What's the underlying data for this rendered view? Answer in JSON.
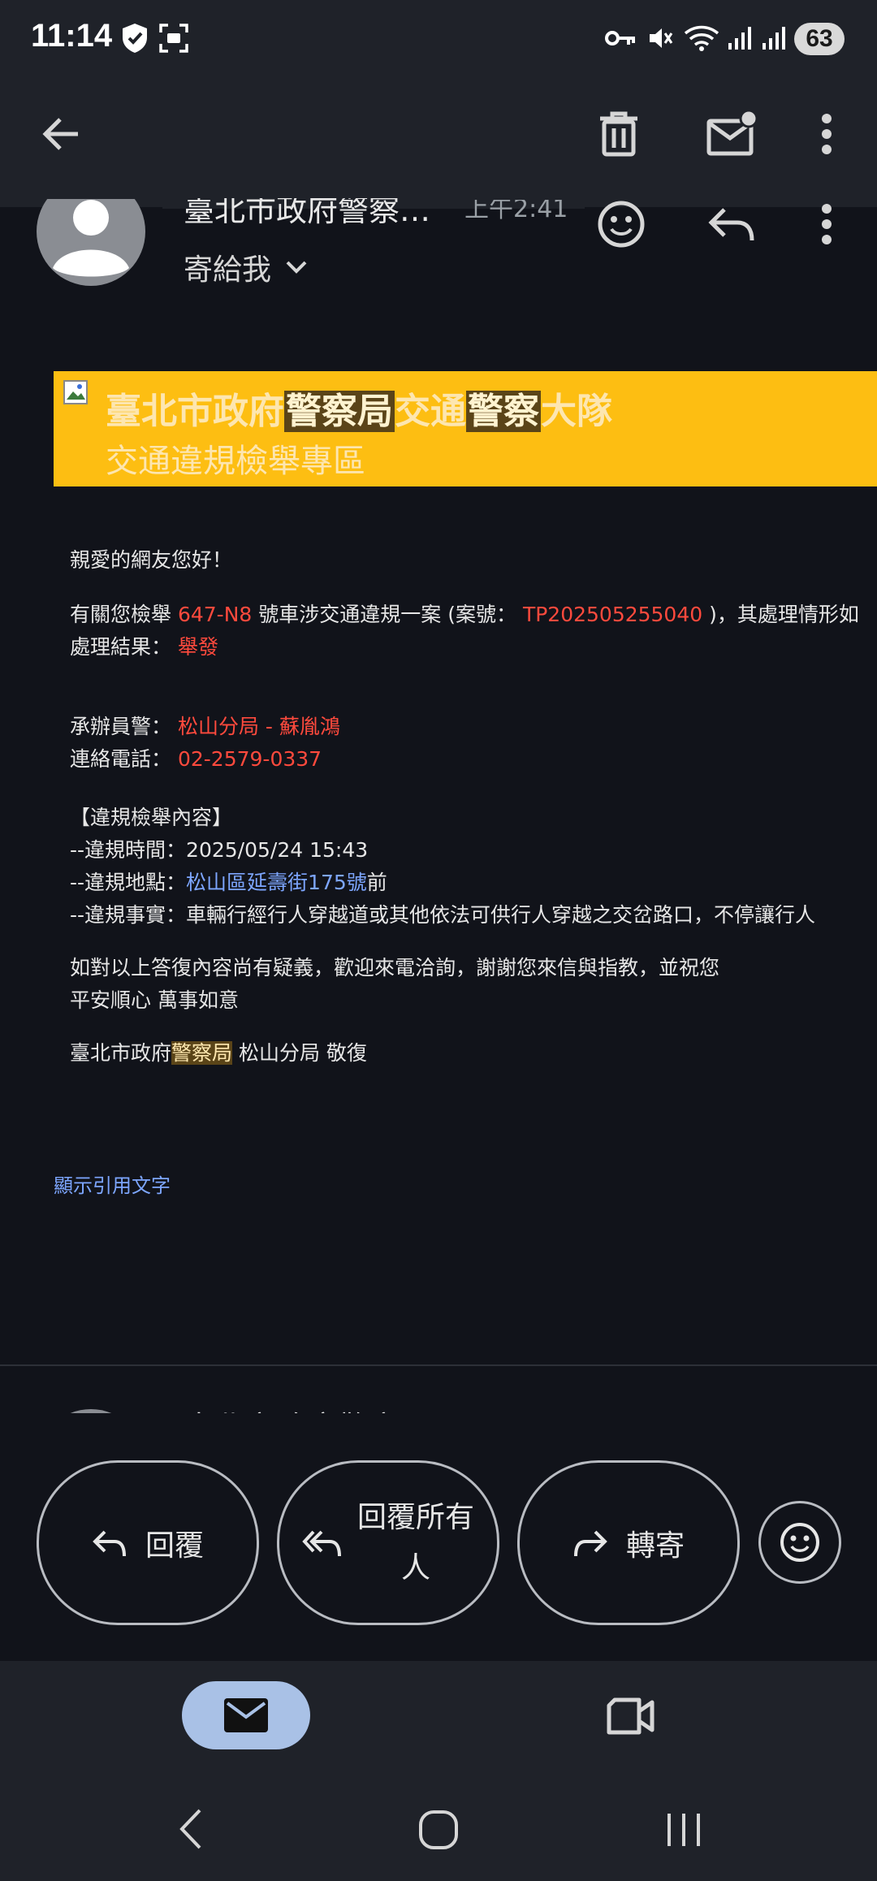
{
  "status_bar": {
    "time": "11:14",
    "battery": "63"
  },
  "sender": {
    "name": "臺北市政府警察…",
    "time": "上午2:41",
    "to_label": "寄給我"
  },
  "banner": {
    "title_parts": [
      "臺北市政府",
      "警察局",
      "交通",
      "警察",
      "大隊"
    ],
    "subtitle": "交通違規檢舉專區"
  },
  "body": {
    "greeting": "親愛的網友您好！",
    "line1_a": "有關您檢舉",
    "plate": "647-N8",
    "line1_b": "號車涉交通違規一案 (案號：",
    "case_no": "TP202505255040",
    "line1_c": ")，其處理情形如",
    "result_label": "處理結果：",
    "result": "舉發",
    "officer_label": "承辦員警：",
    "officer": "松山分局 - 蘇胤鴻",
    "phone_label": "連絡電話：",
    "phone": "02-2579-0337",
    "section_title": "【違規檢舉內容】",
    "time_label": "--違規時間：",
    "time_value": "2025/05/24 15:43",
    "place_label": "--違規地點：",
    "place_value": "松山區延壽街175號",
    "place_suffix": "前",
    "fact_label": "--違規事實：",
    "fact_value": "車輛行經行人穿越道或其他依法可供行人穿越之交岔路口，不停讓行人",
    "closing1": "如對以上答復內容尚有疑義，歡迎來電洽詢，謝謝您來信與指教，並祝您",
    "closing2": "平安順心 萬事如意",
    "sign_a": "臺北市政府",
    "sign_hl": "警察局",
    "sign_b": " 松山分局 敬復"
  },
  "show_quoted": "顯示引用文字",
  "next_sender_partial": "臺北市政府警察",
  "actions": {
    "reply": "回覆",
    "reply_all_1": "回覆所有",
    "reply_all_2": "人",
    "forward": "轉寄"
  },
  "colors": {
    "accent_red": "#ff4a3d",
    "link_blue": "#7da6ff",
    "banner_yellow": "#fdbe12"
  },
  "icons": [
    "back-arrow-icon",
    "trash-icon",
    "mark-unread-icon",
    "more-vert-icon",
    "emoji-icon",
    "reply-icon",
    "reply-all-icon",
    "forward-icon",
    "mail-icon",
    "video-icon"
  ]
}
